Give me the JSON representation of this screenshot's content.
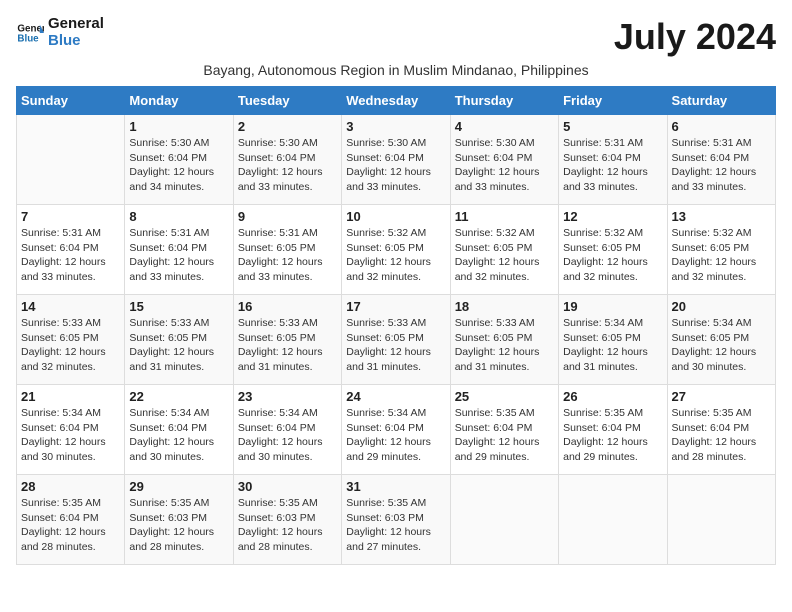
{
  "logo": {
    "line1": "General",
    "line2": "Blue"
  },
  "title": "July 2024",
  "subtitle": "Bayang, Autonomous Region in Muslim Mindanao, Philippines",
  "weekdays": [
    "Sunday",
    "Monday",
    "Tuesday",
    "Wednesday",
    "Thursday",
    "Friday",
    "Saturday"
  ],
  "weeks": [
    [
      {
        "day": "",
        "info": ""
      },
      {
        "day": "1",
        "info": "Sunrise: 5:30 AM\nSunset: 6:04 PM\nDaylight: 12 hours\nand 34 minutes."
      },
      {
        "day": "2",
        "info": "Sunrise: 5:30 AM\nSunset: 6:04 PM\nDaylight: 12 hours\nand 33 minutes."
      },
      {
        "day": "3",
        "info": "Sunrise: 5:30 AM\nSunset: 6:04 PM\nDaylight: 12 hours\nand 33 minutes."
      },
      {
        "day": "4",
        "info": "Sunrise: 5:30 AM\nSunset: 6:04 PM\nDaylight: 12 hours\nand 33 minutes."
      },
      {
        "day": "5",
        "info": "Sunrise: 5:31 AM\nSunset: 6:04 PM\nDaylight: 12 hours\nand 33 minutes."
      },
      {
        "day": "6",
        "info": "Sunrise: 5:31 AM\nSunset: 6:04 PM\nDaylight: 12 hours\nand 33 minutes."
      }
    ],
    [
      {
        "day": "7",
        "info": "Sunrise: 5:31 AM\nSunset: 6:04 PM\nDaylight: 12 hours\nand 33 minutes."
      },
      {
        "day": "8",
        "info": "Sunrise: 5:31 AM\nSunset: 6:04 PM\nDaylight: 12 hours\nand 33 minutes."
      },
      {
        "day": "9",
        "info": "Sunrise: 5:31 AM\nSunset: 6:05 PM\nDaylight: 12 hours\nand 33 minutes."
      },
      {
        "day": "10",
        "info": "Sunrise: 5:32 AM\nSunset: 6:05 PM\nDaylight: 12 hours\nand 32 minutes."
      },
      {
        "day": "11",
        "info": "Sunrise: 5:32 AM\nSunset: 6:05 PM\nDaylight: 12 hours\nand 32 minutes."
      },
      {
        "day": "12",
        "info": "Sunrise: 5:32 AM\nSunset: 6:05 PM\nDaylight: 12 hours\nand 32 minutes."
      },
      {
        "day": "13",
        "info": "Sunrise: 5:32 AM\nSunset: 6:05 PM\nDaylight: 12 hours\nand 32 minutes."
      }
    ],
    [
      {
        "day": "14",
        "info": "Sunrise: 5:33 AM\nSunset: 6:05 PM\nDaylight: 12 hours\nand 32 minutes."
      },
      {
        "day": "15",
        "info": "Sunrise: 5:33 AM\nSunset: 6:05 PM\nDaylight: 12 hours\nand 31 minutes."
      },
      {
        "day": "16",
        "info": "Sunrise: 5:33 AM\nSunset: 6:05 PM\nDaylight: 12 hours\nand 31 minutes."
      },
      {
        "day": "17",
        "info": "Sunrise: 5:33 AM\nSunset: 6:05 PM\nDaylight: 12 hours\nand 31 minutes."
      },
      {
        "day": "18",
        "info": "Sunrise: 5:33 AM\nSunset: 6:05 PM\nDaylight: 12 hours\nand 31 minutes."
      },
      {
        "day": "19",
        "info": "Sunrise: 5:34 AM\nSunset: 6:05 PM\nDaylight: 12 hours\nand 31 minutes."
      },
      {
        "day": "20",
        "info": "Sunrise: 5:34 AM\nSunset: 6:05 PM\nDaylight: 12 hours\nand 30 minutes."
      }
    ],
    [
      {
        "day": "21",
        "info": "Sunrise: 5:34 AM\nSunset: 6:04 PM\nDaylight: 12 hours\nand 30 minutes."
      },
      {
        "day": "22",
        "info": "Sunrise: 5:34 AM\nSunset: 6:04 PM\nDaylight: 12 hours\nand 30 minutes."
      },
      {
        "day": "23",
        "info": "Sunrise: 5:34 AM\nSunset: 6:04 PM\nDaylight: 12 hours\nand 30 minutes."
      },
      {
        "day": "24",
        "info": "Sunrise: 5:34 AM\nSunset: 6:04 PM\nDaylight: 12 hours\nand 29 minutes."
      },
      {
        "day": "25",
        "info": "Sunrise: 5:35 AM\nSunset: 6:04 PM\nDaylight: 12 hours\nand 29 minutes."
      },
      {
        "day": "26",
        "info": "Sunrise: 5:35 AM\nSunset: 6:04 PM\nDaylight: 12 hours\nand 29 minutes."
      },
      {
        "day": "27",
        "info": "Sunrise: 5:35 AM\nSunset: 6:04 PM\nDaylight: 12 hours\nand 28 minutes."
      }
    ],
    [
      {
        "day": "28",
        "info": "Sunrise: 5:35 AM\nSunset: 6:04 PM\nDaylight: 12 hours\nand 28 minutes."
      },
      {
        "day": "29",
        "info": "Sunrise: 5:35 AM\nSunset: 6:03 PM\nDaylight: 12 hours\nand 28 minutes."
      },
      {
        "day": "30",
        "info": "Sunrise: 5:35 AM\nSunset: 6:03 PM\nDaylight: 12 hours\nand 28 minutes."
      },
      {
        "day": "31",
        "info": "Sunrise: 5:35 AM\nSunset: 6:03 PM\nDaylight: 12 hours\nand 27 minutes."
      },
      {
        "day": "",
        "info": ""
      },
      {
        "day": "",
        "info": ""
      },
      {
        "day": "",
        "info": ""
      }
    ]
  ]
}
